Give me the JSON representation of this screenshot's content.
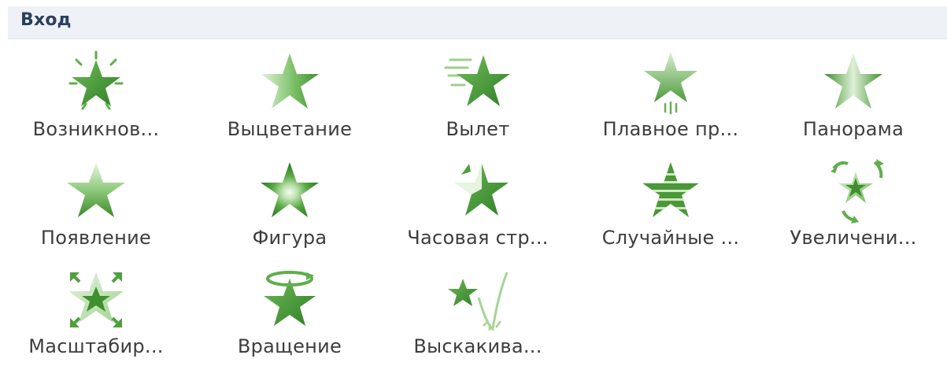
{
  "header": {
    "title": "Вход"
  },
  "colors": {
    "star_dark": "#3f8f2f",
    "star_light": "#a9d798",
    "header_bg": "#eef1f5"
  },
  "effects": [
    {
      "label": "Возникнов...",
      "icon": "appear-burst-star-icon"
    },
    {
      "label": "Выцветание",
      "icon": "fade-star-icon"
    },
    {
      "label": "Вылет",
      "icon": "fly-in-star-icon"
    },
    {
      "label": "Плавное пр...",
      "icon": "float-in-star-icon"
    },
    {
      "label": "Панорама",
      "icon": "split-star-icon"
    },
    {
      "label": "Появление",
      "icon": "wipe-star-icon"
    },
    {
      "label": "Фигура",
      "icon": "shape-star-icon"
    },
    {
      "label": "Часовая стр...",
      "icon": "wheel-star-icon"
    },
    {
      "label": "Случайные ...",
      "icon": "random-bars-star-icon"
    },
    {
      "label": "Увеличени...",
      "icon": "grow-turn-star-icon"
    },
    {
      "label": "Масштабир...",
      "icon": "zoom-star-icon"
    },
    {
      "label": "Вращение",
      "icon": "swivel-star-icon"
    },
    {
      "label": "Выскакива...",
      "icon": "bounce-star-icon"
    }
  ]
}
